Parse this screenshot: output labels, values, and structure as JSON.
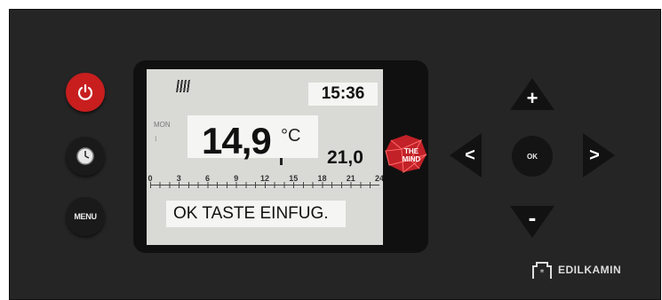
{
  "buttons": {
    "menu_label": "MENU",
    "ok_label": "OK",
    "up_label": "+",
    "down_label": "-",
    "left_label": "<",
    "right_label": ">"
  },
  "display": {
    "time": "15:36",
    "day": "MON",
    "room_temperature": "14,9",
    "unit": "°C",
    "setpoint": "21,0",
    "scale_ticks": [
      "0",
      "3",
      "6",
      "9",
      "12",
      "15",
      "18",
      "21",
      "24"
    ],
    "message": "OK TASTE EINFUG."
  },
  "logo": {
    "line1": "THE",
    "line2": "MIND"
  },
  "brand": {
    "name": "EDILKAMIN"
  },
  "colors": {
    "panel": "#252525",
    "power": "#c81e1e",
    "screen": "#d9d9d5",
    "logo": "#e0252b"
  },
  "icons": [
    "power-icon",
    "clock-icon",
    "flame-icon",
    "the-mind-logo",
    "edilkamin-logo"
  ]
}
